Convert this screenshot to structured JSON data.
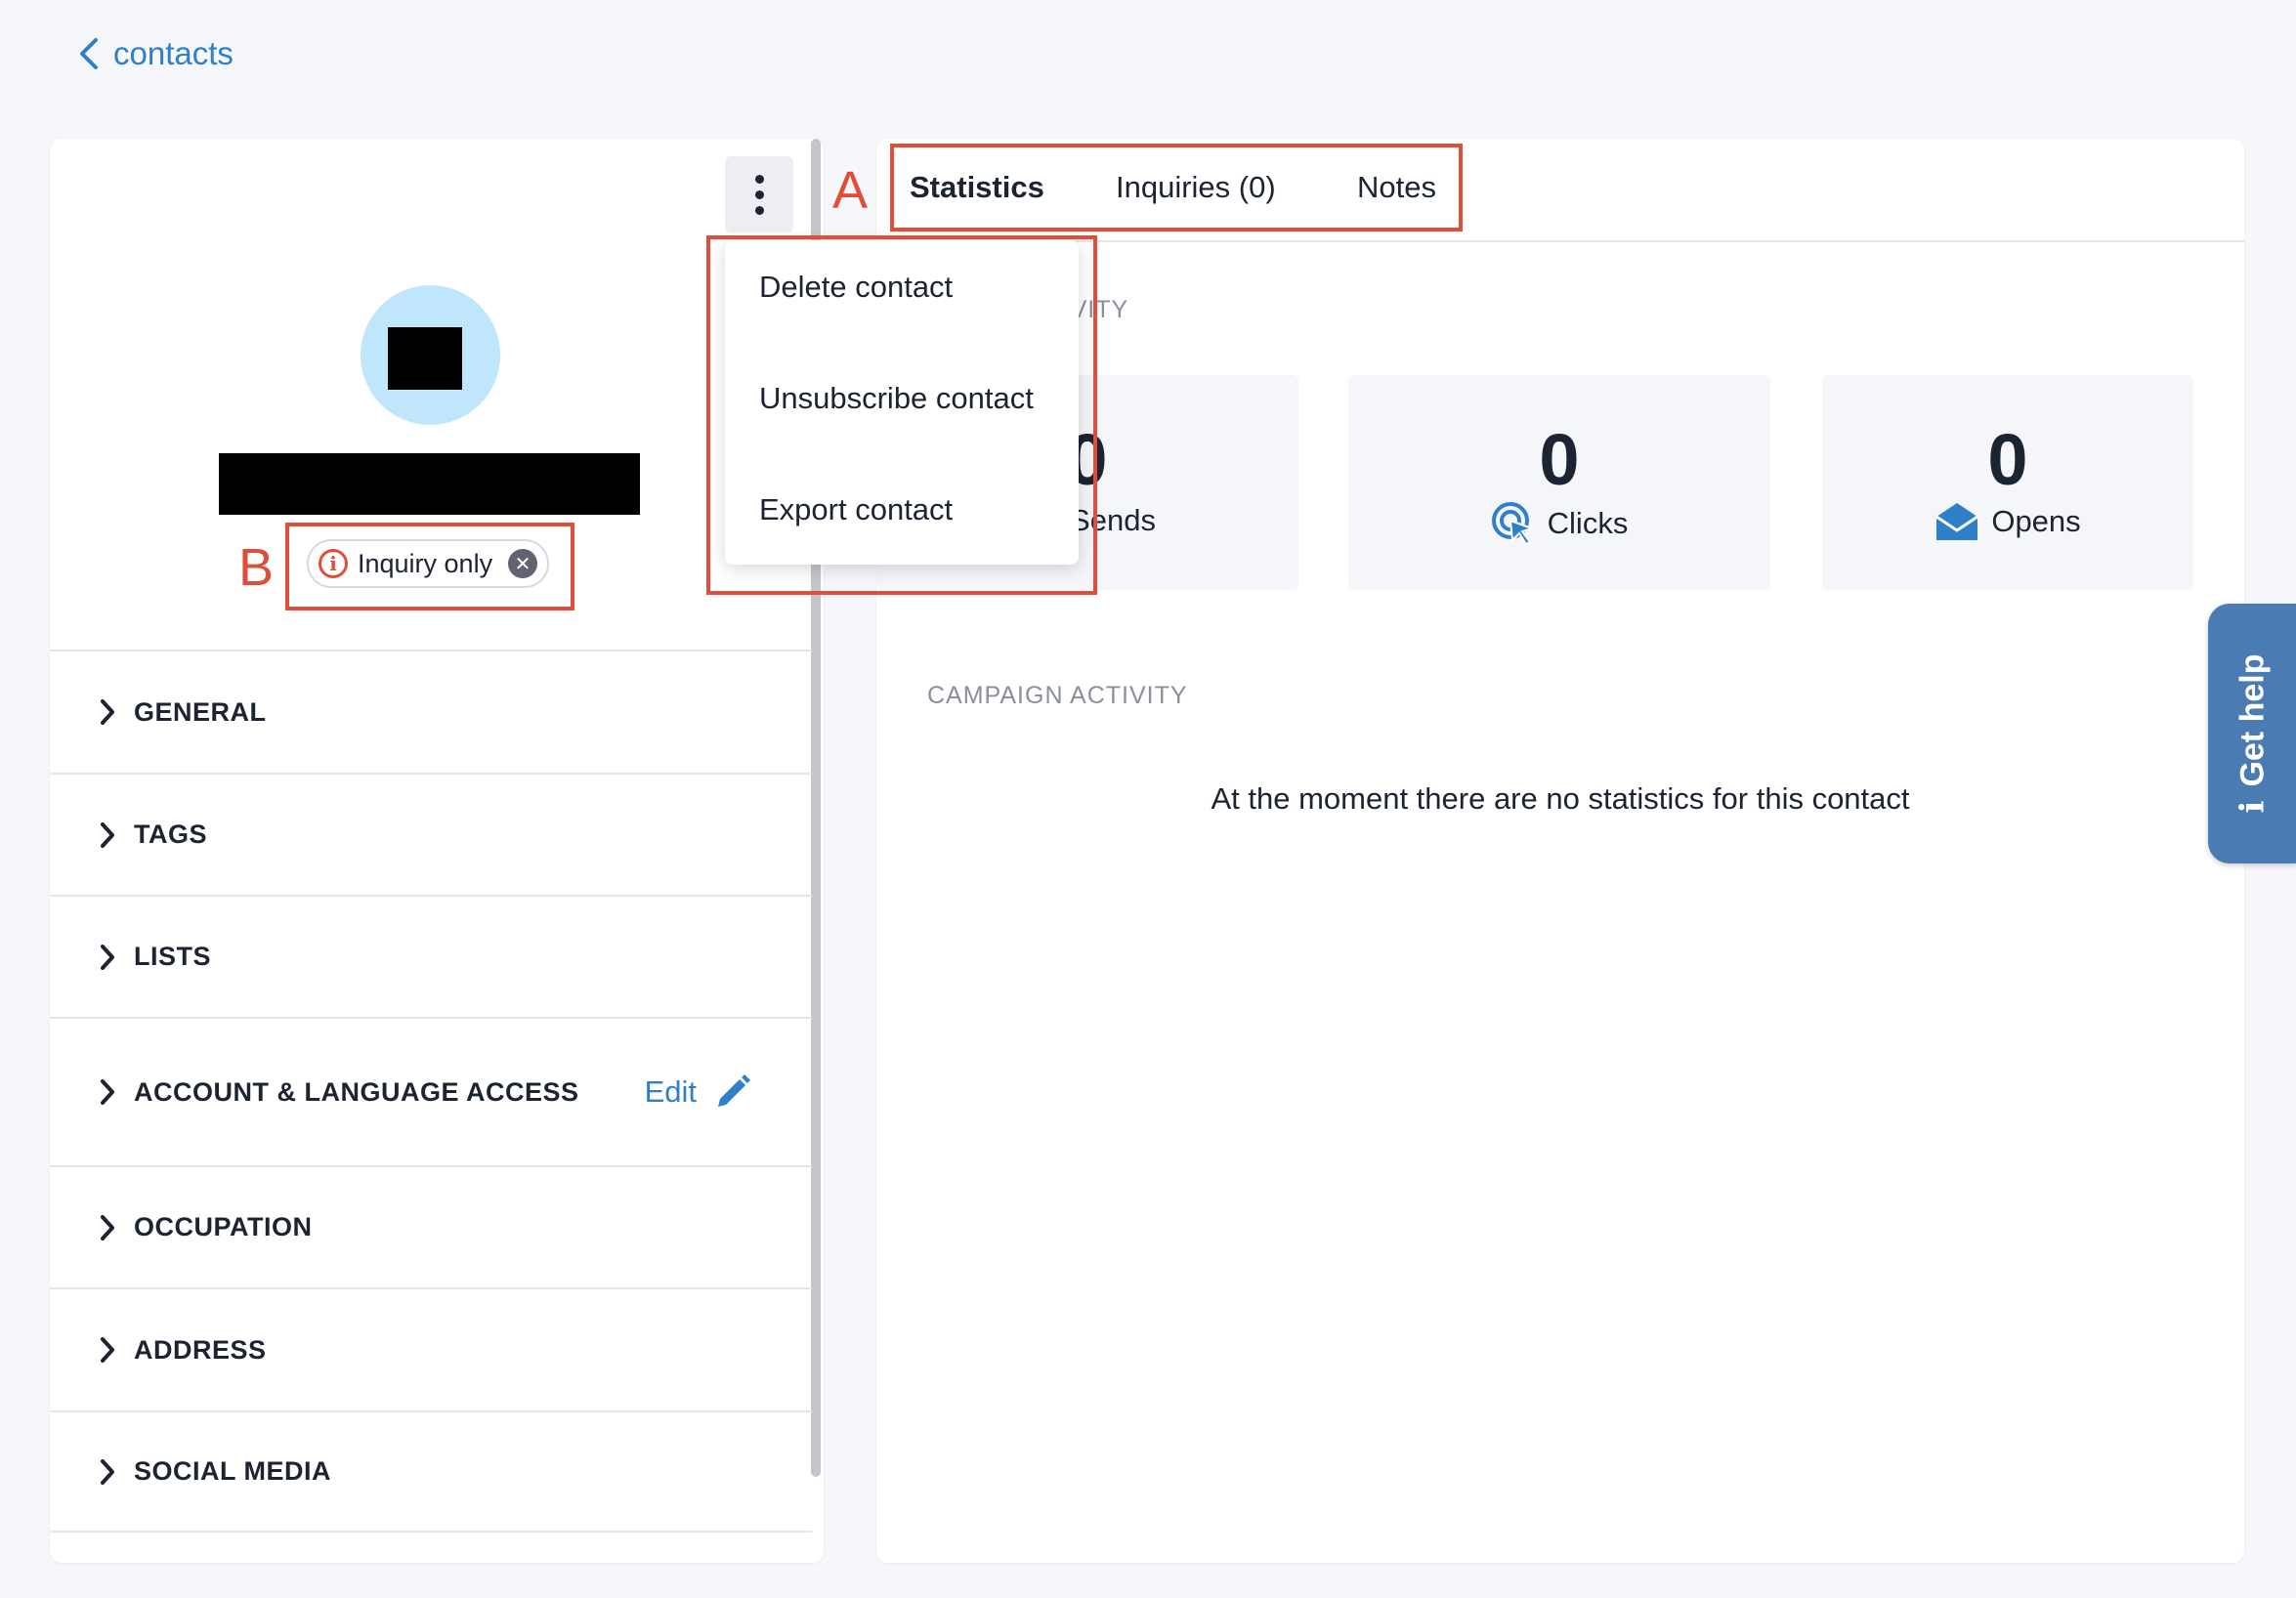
{
  "nav": {
    "back_label": "contacts"
  },
  "contact": {
    "status_chip": "Inquiry only"
  },
  "sections": [
    {
      "label": "GENERAL"
    },
    {
      "label": "TAGS"
    },
    {
      "label": "LISTS"
    },
    {
      "label": "ACCOUNT & LANGUAGE ACCESS",
      "action": "Edit"
    },
    {
      "label": "OCCUPATION"
    },
    {
      "label": "ADDRESS"
    },
    {
      "label": "SOCIAL MEDIA"
    }
  ],
  "tabs": [
    {
      "label": "Statistics",
      "active": true
    },
    {
      "label": "Inquiries (0)",
      "active": false
    },
    {
      "label": "Notes",
      "active": false
    }
  ],
  "email_activity": {
    "label": "EMAIL ACTIVITY",
    "stats": [
      {
        "value": "0",
        "label": "Sends",
        "icon": "send-icon"
      },
      {
        "value": "0",
        "label": "Clicks",
        "icon": "cursor-click-icon"
      },
      {
        "value": "0",
        "label": "Opens",
        "icon": "envelope-open-icon"
      }
    ]
  },
  "campaign_activity": {
    "label": "CAMPAIGN ACTIVITY",
    "empty_text": "At the moment there are no statistics for this contact"
  },
  "menu": {
    "items": [
      {
        "label": "Delete contact"
      },
      {
        "label": "Unsubscribe contact"
      },
      {
        "label": "Export contact"
      }
    ]
  },
  "annotations": {
    "a": "A",
    "b": "B"
  },
  "help": {
    "label": "Get help"
  },
  "colors": {
    "accent": "#2f80c8",
    "annotation": "#e04e39",
    "help_tab": "#4a7bb3",
    "avatar": "#bfe6fa"
  }
}
